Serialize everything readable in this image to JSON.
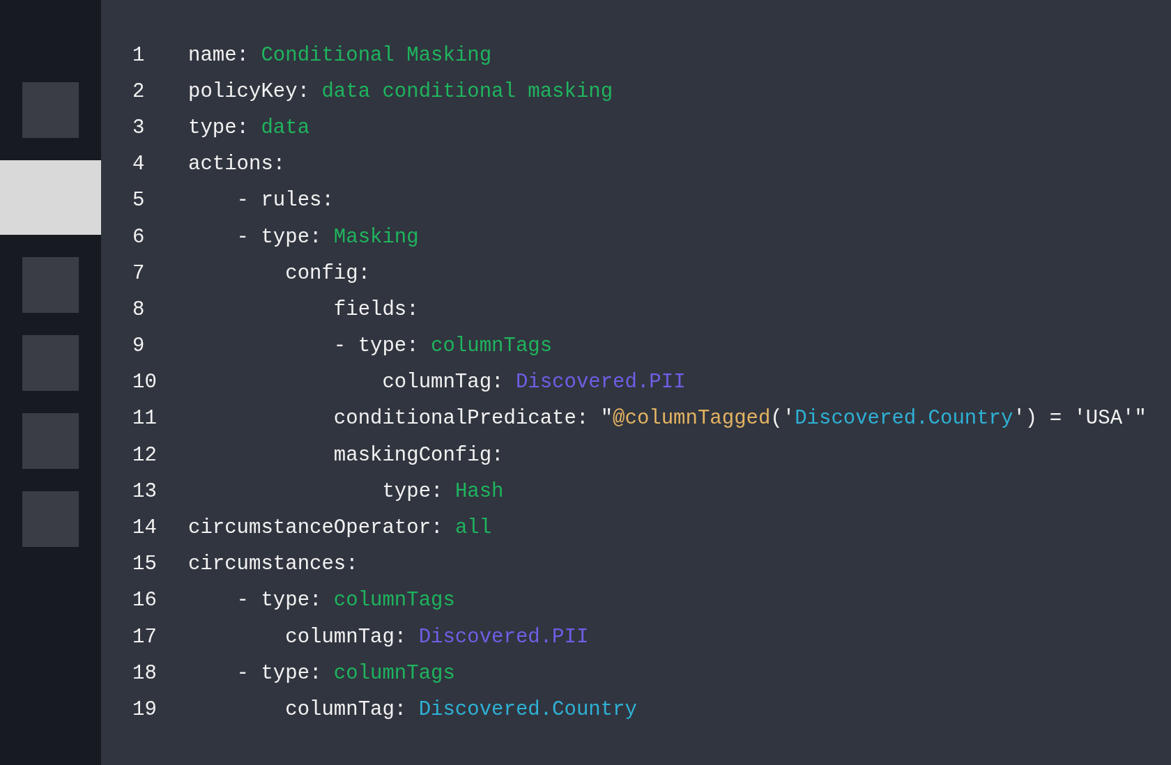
{
  "sidebar": {
    "items": [
      {
        "selected": false
      },
      {
        "selected": true
      },
      {
        "selected": false
      },
      {
        "selected": false
      },
      {
        "selected": false
      },
      {
        "selected": false
      }
    ]
  },
  "editor": {
    "lines": [
      {
        "number": "1",
        "tokens": [
          {
            "kind": "key",
            "text": "name: "
          },
          {
            "kind": "value",
            "text": "Conditional Masking"
          }
        ]
      },
      {
        "number": "2",
        "tokens": [
          {
            "kind": "key",
            "text": "policyKey: "
          },
          {
            "kind": "value",
            "text": "data conditional masking"
          }
        ]
      },
      {
        "number": "3",
        "tokens": [
          {
            "kind": "key",
            "text": "type: "
          },
          {
            "kind": "value",
            "text": "data"
          }
        ]
      },
      {
        "number": "4",
        "tokens": [
          {
            "kind": "key",
            "text": "actions:"
          }
        ]
      },
      {
        "number": "5",
        "tokens": [
          {
            "kind": "key",
            "text": "    - rules:"
          }
        ]
      },
      {
        "number": "6",
        "tokens": [
          {
            "kind": "key",
            "text": "    - type: "
          },
          {
            "kind": "value",
            "text": "Masking"
          }
        ]
      },
      {
        "number": "7",
        "tokens": [
          {
            "kind": "key",
            "text": "        config:"
          }
        ]
      },
      {
        "number": "8",
        "tokens": [
          {
            "kind": "key",
            "text": "            fields:"
          }
        ]
      },
      {
        "number": "9",
        "tokens": [
          {
            "kind": "key",
            "text": "            - type: "
          },
          {
            "kind": "value",
            "text": "columnTags"
          }
        ]
      },
      {
        "number": "10",
        "tokens": [
          {
            "kind": "key",
            "text": "                columnTag: "
          },
          {
            "kind": "tag",
            "text": "Discovered.PII"
          }
        ]
      },
      {
        "number": "11",
        "tokens": [
          {
            "kind": "key",
            "text": "            conditionalPredicate: \""
          },
          {
            "kind": "function",
            "text": "@columnTagged"
          },
          {
            "kind": "key",
            "text": "('"
          },
          {
            "kind": "tag2",
            "text": "Discovered.Country"
          },
          {
            "kind": "key",
            "text": "') = 'USA'\""
          }
        ]
      },
      {
        "number": "12",
        "tokens": [
          {
            "kind": "key",
            "text": "            maskingConfig:"
          }
        ]
      },
      {
        "number": "13",
        "tokens": [
          {
            "kind": "key",
            "text": "                type: "
          },
          {
            "kind": "value",
            "text": "Hash"
          }
        ]
      },
      {
        "number": "14",
        "tokens": [
          {
            "kind": "key",
            "text": "circumstanceOperator: "
          },
          {
            "kind": "value",
            "text": "all"
          }
        ]
      },
      {
        "number": "15",
        "tokens": [
          {
            "kind": "key",
            "text": "circumstances:"
          }
        ]
      },
      {
        "number": "16",
        "tokens": [
          {
            "kind": "key",
            "text": "    - type: "
          },
          {
            "kind": "value",
            "text": "columnTags"
          }
        ]
      },
      {
        "number": "17",
        "tokens": [
          {
            "kind": "key",
            "text": "        columnTag: "
          },
          {
            "kind": "tag",
            "text": "Discovered.PII"
          }
        ]
      },
      {
        "number": "18",
        "tokens": [
          {
            "kind": "key",
            "text": "    - type: "
          },
          {
            "kind": "value",
            "text": "columnTags"
          }
        ]
      },
      {
        "number": "19",
        "tokens": [
          {
            "kind": "key",
            "text": "        columnTag: "
          },
          {
            "kind": "tag2",
            "text": "Discovered.Country"
          }
        ]
      }
    ]
  }
}
